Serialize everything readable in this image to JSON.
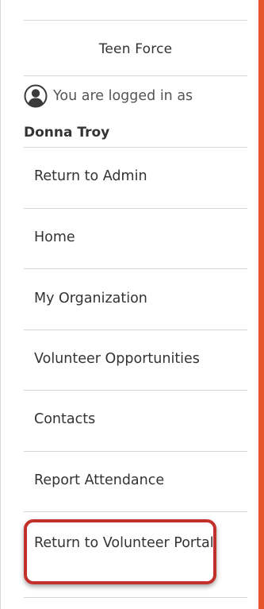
{
  "sidebar": {
    "org_name": "Teen Force",
    "logged_in_text": "You are logged in as",
    "user_name": "Donna Troy",
    "nav": {
      "return_admin": "Return to Admin",
      "home": "Home",
      "my_org": "My Organization",
      "opportunities": "Volunteer Opportunities",
      "contacts": "Contacts",
      "attendance": "Report Attendance",
      "return_portal": "Return to Volunteer Portal"
    }
  },
  "colors": {
    "accent_bar": "#e5572a",
    "highlight": "#c2302c"
  },
  "icons": {
    "avatar": "user-avatar-icon"
  }
}
